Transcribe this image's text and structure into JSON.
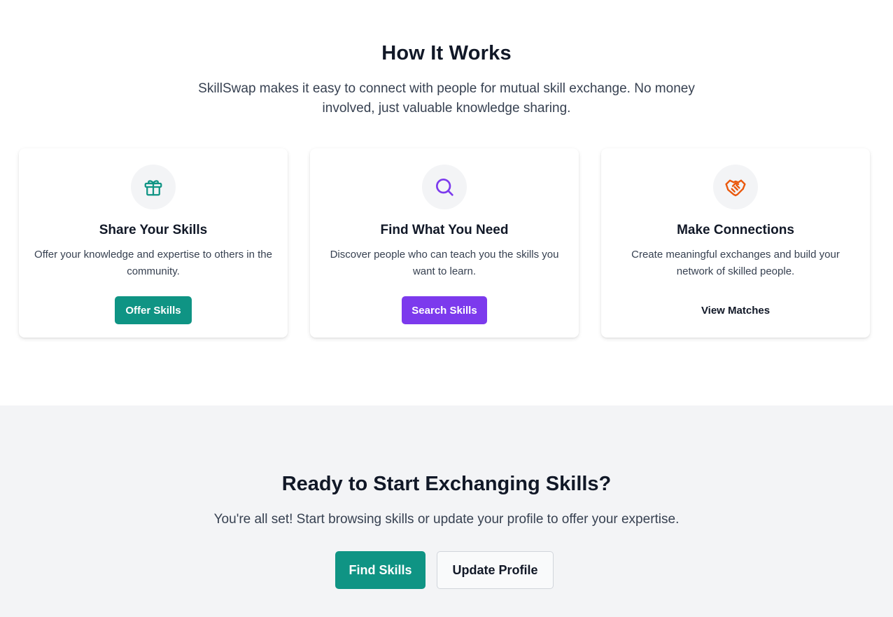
{
  "how_it_works": {
    "title": "How It Works",
    "description": "SkillSwap makes it easy to connect with people for mutual skill exchange. No money involved, just valuable knowledge sharing.",
    "cards": [
      {
        "icon": "gift-icon",
        "icon_color": "#0f9484",
        "title": "Share Your Skills",
        "description": "Offer your knowledge and expertise to others in the community.",
        "button_label": "Offer Skills",
        "button_color": "#0f9484"
      },
      {
        "icon": "search-icon",
        "icon_color": "#7c3aed",
        "title": "Find What You Need",
        "description": "Discover people who can teach you the skills you want to learn.",
        "button_label": "Search Skills",
        "button_color": "#7c3aed"
      },
      {
        "icon": "handshake-icon",
        "icon_color": "#ea580c",
        "title": "Make Connections",
        "description": "Create meaningful exchanges and build your network of skilled people.",
        "button_label": "View Matches"
      }
    ]
  },
  "cta": {
    "title": "Ready to Start Exchanging Skills?",
    "description": "You're all set! Start browsing skills or update your profile to offer your expertise.",
    "primary_label": "Find Skills",
    "secondary_label": "Update Profile"
  }
}
